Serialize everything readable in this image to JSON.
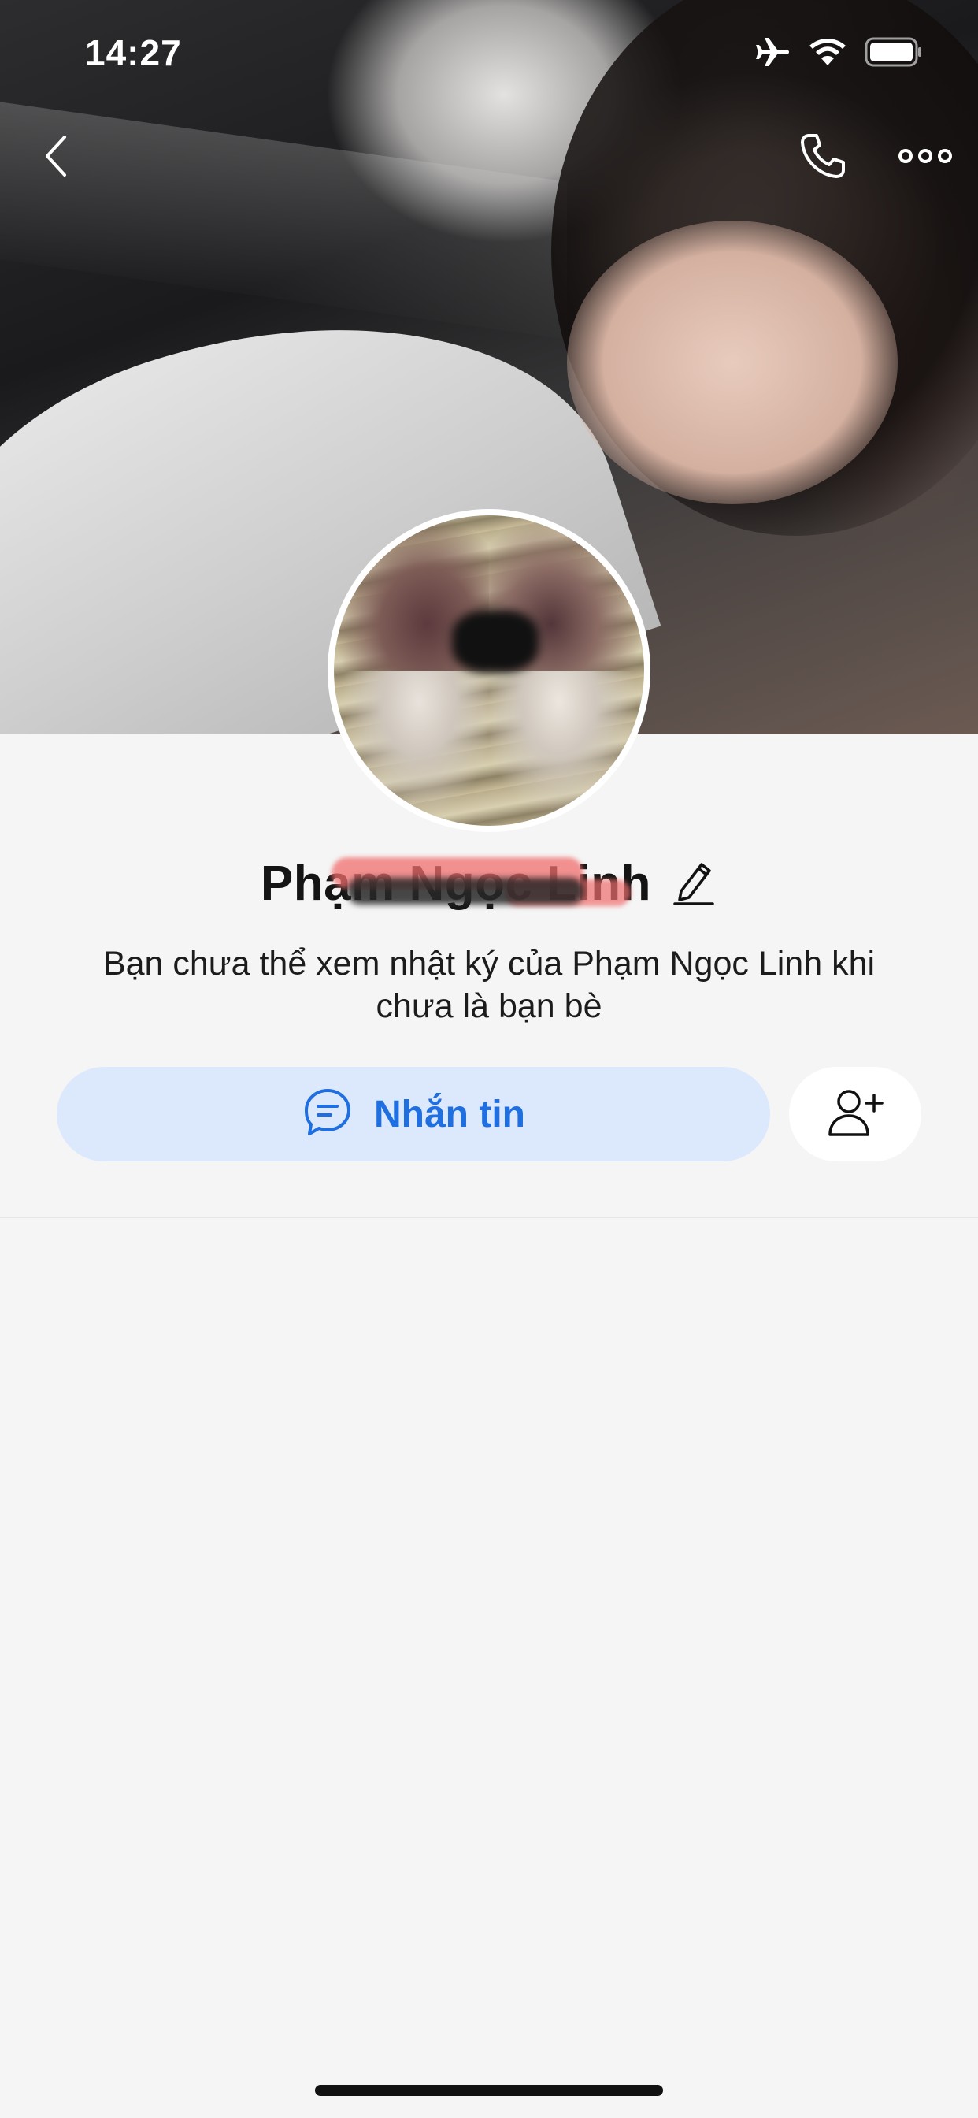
{
  "status_bar": {
    "time": "14:27",
    "icons": [
      "airplane-mode-icon",
      "wifi-icon",
      "battery-icon"
    ]
  },
  "nav": {
    "back_icon": "chevron-left-icon",
    "call_icon": "phone-icon",
    "more_icon": "more-horizontal-icon"
  },
  "profile": {
    "name": "Phạm Ngọc Linh",
    "edit_icon": "pencil-icon",
    "diary_note": "Bạn chưa thể xem nhật ký của Phạm Ngọc Linh khi chưa là bạn bè"
  },
  "actions": {
    "message_label": "Nhắn tin",
    "message_icon": "chat-bubble-icon",
    "add_friend_icon": "add-friend-icon"
  },
  "colors": {
    "accent": "#1f6fe0",
    "message_button_bg": "#dce9fc",
    "page_bg": "#f5f5f5"
  }
}
